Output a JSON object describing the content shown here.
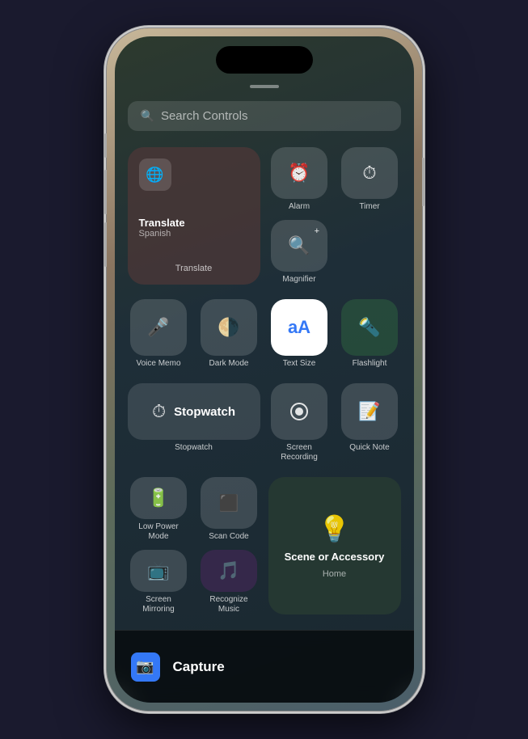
{
  "phone": {
    "search": {
      "placeholder": "Search Controls"
    },
    "controls": {
      "translate": {
        "name": "Translate",
        "subtitle": "Spanish",
        "label": "Translate"
      },
      "alarm": {
        "label": "Alarm"
      },
      "timer": {
        "label": "Timer"
      },
      "magnifier": {
        "label": "Magnifier"
      },
      "voice_memo": {
        "label": "Voice Memo"
      },
      "dark_mode": {
        "label": "Dark Mode"
      },
      "text_size": {
        "label": "Text Size"
      },
      "flashlight": {
        "label": "Flashlight"
      },
      "stopwatch": {
        "label": "Stopwatch",
        "name": "Stopwatch"
      },
      "screen_recording": {
        "label": "Screen\nRecording"
      },
      "quick_note": {
        "label": "Quick Note"
      },
      "low_power": {
        "label": "Low Power\nMode"
      },
      "scan_code": {
        "label": "Scan Code"
      },
      "screen_mirroring": {
        "label": "Screen\nMirroring"
      },
      "recognize_music": {
        "label": "Recognize\nMusic"
      },
      "home": {
        "label": "Scene or Accessory",
        "sub": "Home"
      }
    },
    "bottom_bar": {
      "label": "Capture",
      "icon": "📷"
    }
  }
}
